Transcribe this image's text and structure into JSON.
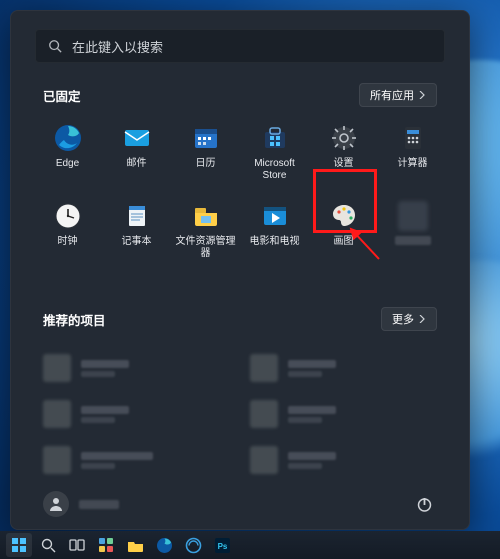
{
  "search": {
    "placeholder": "在此键入以搜索"
  },
  "pinned": {
    "title": "已固定",
    "button": "所有应用",
    "apps": [
      {
        "id": "edge",
        "label": "Edge"
      },
      {
        "id": "mail",
        "label": "邮件"
      },
      {
        "id": "calendar",
        "label": "日历"
      },
      {
        "id": "store",
        "label": "Microsoft Store"
      },
      {
        "id": "settings",
        "label": "设置"
      },
      {
        "id": "calculator",
        "label": "计算器"
      },
      {
        "id": "clock",
        "label": "时钟"
      },
      {
        "id": "notepad",
        "label": "记事本"
      },
      {
        "id": "explorer",
        "label": "文件资源管理器"
      },
      {
        "id": "movies",
        "label": "电影和电视"
      },
      {
        "id": "paint",
        "label": "画图"
      },
      {
        "id": "censored",
        "label": ""
      }
    ]
  },
  "recommended": {
    "title": "推荐的项目",
    "button": "更多"
  },
  "annotation": {
    "highlight_app": "paint",
    "highlight_color": "#ff1a1a"
  }
}
